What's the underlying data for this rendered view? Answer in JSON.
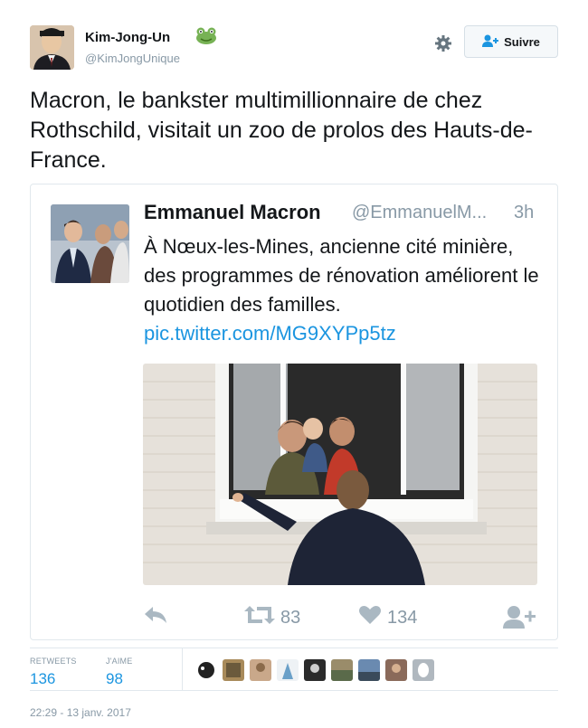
{
  "tweet": {
    "author_name": "Kim-Jong-Un",
    "author_handle": "@KimJongUnique",
    "follow_label": "Suivre",
    "text": "Macron, le bankster multimillionnaire de chez Rothschild, visitait un zoo de prolos des Hauts-de-France.",
    "timestamp": "22:29 - 13 janv. 2017"
  },
  "quoted": {
    "name": "Emmanuel Macron",
    "handle": "@EmmanuelM...",
    "time": "3h",
    "text": "À Nœux-les-Mines, ancienne cité minière, des programmes de rénovation améliorent le quotidien des familles.",
    "link": "pic.twitter.com/MG9XYPp5tz",
    "retweets": "83",
    "likes": "134"
  },
  "stats": {
    "retweets_label": "RETWEETS",
    "retweets_value": "136",
    "likes_label": "J'AIME",
    "likes_value": "98"
  },
  "colors": {
    "link": "#1b95e0",
    "muted": "#8899a6",
    "border": "#e1e8ed"
  },
  "icons": [
    "gear-icon",
    "follow-user-icon",
    "frog-emoji",
    "reply-icon",
    "retweet-icon",
    "heart-icon",
    "follow-add-icon"
  ]
}
